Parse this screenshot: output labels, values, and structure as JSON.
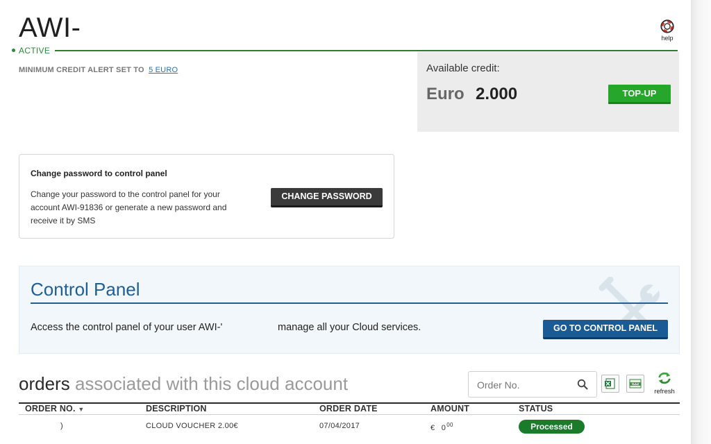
{
  "header": {
    "account_title": "AWI-",
    "status": "ACTIVE",
    "help_label": "help"
  },
  "credit_alert": {
    "label": "MINIMUM CREDIT ALERT SET TO",
    "value_link": "5 EURO"
  },
  "credit": {
    "label": "Available credit:",
    "currency": "Euro",
    "amount": "2.000",
    "topup_label": "TOP-UP"
  },
  "password_card": {
    "title": "Change password to control panel",
    "description": "Change your password to the control panel for your account AWI-91836 or generate a new password and receive it by SMS",
    "button_label": "CHANGE PASSWORD"
  },
  "control_panel": {
    "title": "Control Panel",
    "description_start": "Access the control panel of your user AWI-'",
    "description_end": "manage all your Cloud services.",
    "button_label": "GO TO CONTROL PANEL"
  },
  "orders": {
    "title": "orders",
    "subtitle": "associated with this cloud account",
    "search_placeholder": "Order No.",
    "refresh_label": "refresh",
    "columns": [
      "ORDER NO.",
      "DESCRIPTION",
      "ORDER DATE",
      "AMOUNT",
      "STATUS"
    ],
    "rows": [
      {
        "order_no": ")",
        "description": "CLOUD VOUCHER 2.00€",
        "date": "07/04/2017",
        "amount_symbol": "€",
        "amount_int": "0",
        "amount_dec": "00",
        "status": "Processed"
      }
    ]
  },
  "colors": {
    "active_green": "#2a8a3a",
    "topup_green": "#27a62c",
    "control_blue": "#1f5f95",
    "badge_green": "#1a7b2b"
  }
}
